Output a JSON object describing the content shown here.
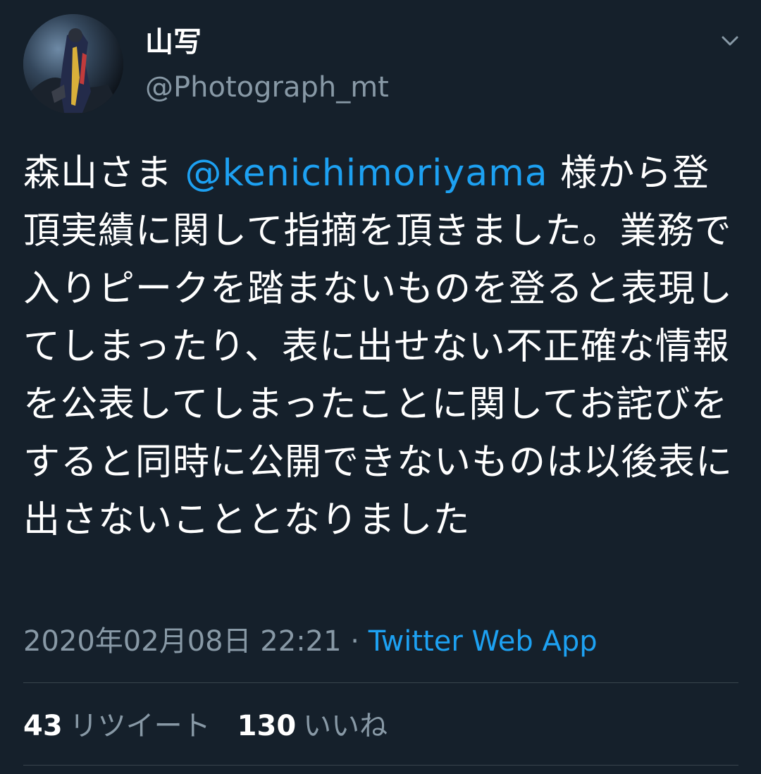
{
  "user": {
    "display_name": "山写",
    "handle": "@Photograph_mt"
  },
  "tweet": {
    "text_before": "森山さま ",
    "mention": "@kenichimoriyama",
    "text_after": " 様から登頂実績に関して指摘を頂きました。業務で入りピークを踏まないものを登ると表現してしまったり、表に出せない不正確な情報を公表してしまったことに関してお詫びをすると同時に公開できないものは以後表に出さないこととなりました",
    "timestamp": "2020年02月08日 22:21",
    "separator": " · ",
    "source": "Twitter Web App"
  },
  "stats": {
    "retweets_count": "43",
    "retweets_label": "リツイート",
    "likes_count": "130",
    "likes_label": "いいね"
  },
  "icons": {
    "menu": "chevron-down-icon",
    "avatar": "profile-avatar"
  },
  "colors": {
    "background": "#15202b",
    "accent": "#1da1f2",
    "secondary_text": "#8899a6",
    "divider": "#38444d"
  }
}
